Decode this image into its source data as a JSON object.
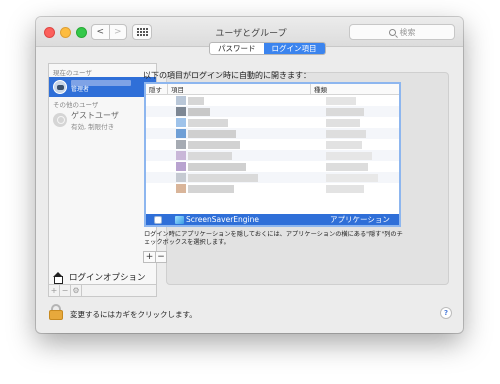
{
  "window": {
    "title": "ユーザとグループ"
  },
  "toolbar": {
    "back": "<",
    "forward": ">",
    "search_placeholder": "検索"
  },
  "sidebar": {
    "current_header": "現在のユーザ",
    "current_user_role": "管理者",
    "other_header": "その他のユーザ",
    "guest_name": "ゲストユーザ",
    "guest_status": "有効, 制限付き",
    "login_options": "ログインオプション",
    "add": "+",
    "remove": "−",
    "gear": "⚙"
  },
  "tabs": [
    {
      "label": "パスワード",
      "active": false
    },
    {
      "label": "ログイン項目",
      "active": true
    }
  ],
  "login_items": {
    "intro": "以下の項目がログイン時に自動的に開きます：",
    "columns": {
      "hide": "隠す",
      "item": "項目",
      "kind": "種類"
    },
    "blurred_rows": [
      {
        "icon": "#b9c7d8",
        "text_w": "16",
        "text_color": "#d6d6d6",
        "kind_w": "30",
        "kind_color": "#e4e4e4",
        "alt": false
      },
      {
        "icon": "#7d8794",
        "text_w": "22",
        "text_color": "#c8c8c8",
        "kind_w": "38",
        "kind_color": "#dadada",
        "alt": true
      },
      {
        "icon": "#9fc3ea",
        "text_w": "40",
        "text_color": "#d8d8d8",
        "kind_w": "34",
        "kind_color": "#e0e0e0",
        "alt": false
      },
      {
        "icon": "#6f9fd6",
        "text_w": "48",
        "text_color": "#cfcfcf",
        "kind_w": "40",
        "kind_color": "#dedede",
        "alt": true
      },
      {
        "icon": "#a6abb3",
        "text_w": "52",
        "text_color": "#d2d2d2",
        "kind_w": "36",
        "kind_color": "#e2e2e2",
        "alt": false
      },
      {
        "icon": "#c9b7d8",
        "text_w": "44",
        "text_color": "#d9d9d9",
        "kind_w": "46",
        "kind_color": "#e6e6e6",
        "alt": true
      },
      {
        "icon": "#b9a3d0",
        "text_w": "58",
        "text_color": "#d0d0d0",
        "kind_w": "42",
        "kind_color": "#dddddd",
        "alt": false
      },
      {
        "icon": "#c5cad2",
        "text_w": "70",
        "text_color": "#dadada",
        "kind_w": "52",
        "kind_color": "#e8e8e8",
        "alt": true
      },
      {
        "icon": "#d9b59a",
        "text_w": "46",
        "text_color": "#d4d4d4",
        "kind_w": "38",
        "kind_color": "#e3e3e3",
        "alt": false
      }
    ],
    "selected_item": {
      "name": "ScreenSaverEngine",
      "kind": "アプリケーション"
    },
    "note": "ログイン時にアプリケーションを隠しておくには、アプリケーションの横にある\"隠す\"列のチェックボックスを選択します。",
    "add": "+",
    "remove": "−"
  },
  "footer": {
    "lock_text": "変更するにはカギをクリックします。",
    "help": "?"
  }
}
